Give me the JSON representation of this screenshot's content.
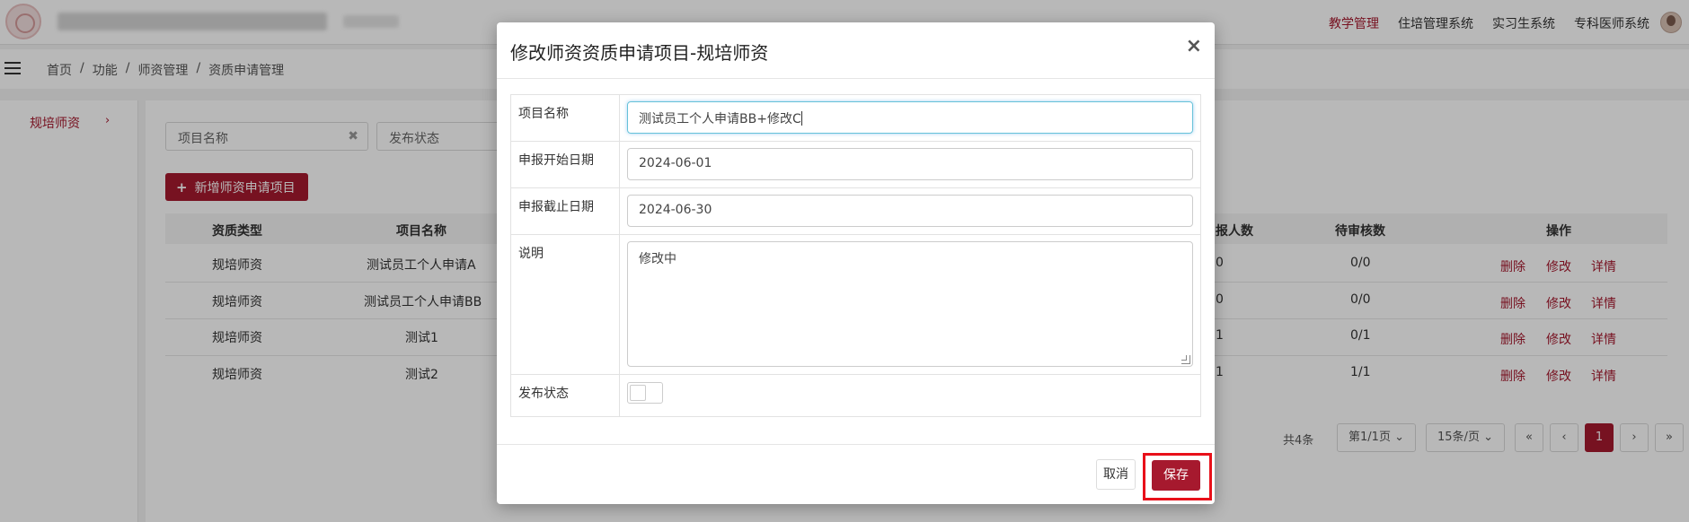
{
  "topbar": {
    "nav": [
      "教学管理",
      "住培管理系统",
      "实习生系统",
      "专科医师系统"
    ]
  },
  "breadcrumb": [
    "首页",
    "/",
    "功能",
    "/",
    "师资管理",
    "/",
    "资质申请管理"
  ],
  "sidebar": {
    "item": "规培师资",
    "arrow": "›"
  },
  "filters": {
    "project_name": "项目名称",
    "clear": "✖",
    "status": "发布状态"
  },
  "toolbar": {
    "add_label": "新增师资申请项目",
    "add_icon": "+"
  },
  "table": {
    "headers": [
      "资质类型",
      "项目名称",
      "报人数",
      "待审核数",
      "操作"
    ],
    "rows": [
      {
        "type": "规培师资",
        "name": "测试员工个人申请A",
        "count": "0",
        "pending": "0/0"
      },
      {
        "type": "规培师资",
        "name": "测试员工个人申请BB",
        "count": "0",
        "pending": "0/0"
      },
      {
        "type": "规培师资",
        "name": "测试1",
        "count": "1",
        "pending": "0/1"
      },
      {
        "type": "规培师资",
        "name": "测试2",
        "count": "1",
        "pending": "1/1"
      }
    ],
    "ops": [
      "删除",
      "修改",
      "详情"
    ]
  },
  "pagination": {
    "total": "共4条",
    "page_info": "第1/1页 ⌄",
    "per_page": "15条/页 ⌄",
    "first": "«",
    "prev": "‹",
    "current": "1",
    "next": "›",
    "last": "»"
  },
  "modal": {
    "title": "修改师资资质申请项目-规培师资",
    "close": "×",
    "fields": {
      "name_label": "项目名称",
      "name_value": "测试员工个人申请BB+修改C",
      "start_label": "申报开始日期",
      "start_value": "2024-06-01",
      "end_label": "申报截止日期",
      "end_value": "2024-06-30",
      "desc_label": "说明",
      "desc_value": "修改中",
      "status_label": "发布状态"
    },
    "status_on": false,
    "cancel_label": "取消",
    "save_label": "保存"
  },
  "colors": {
    "brand": "#a6192e",
    "highlight": "#e8101a"
  }
}
